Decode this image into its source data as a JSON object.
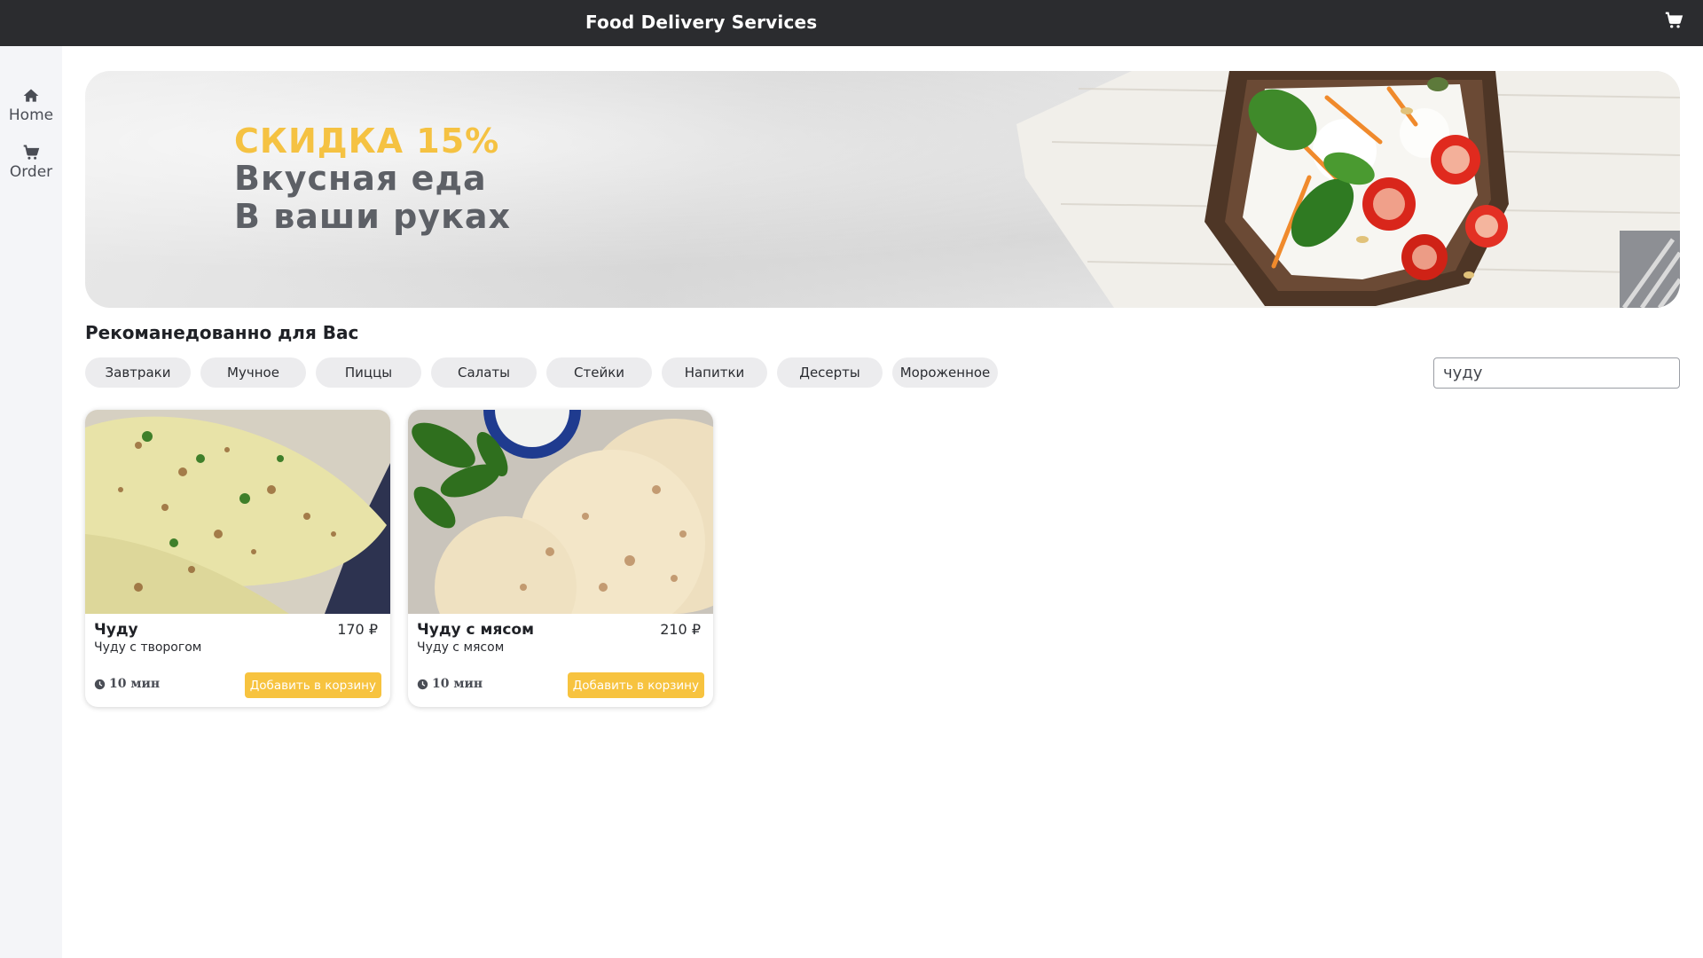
{
  "header": {
    "title": "Food Delivery Services",
    "cart_icon": "cart-icon"
  },
  "sidebar": {
    "items": [
      {
        "label": "Home",
        "icon": "home-icon"
      },
      {
        "label": "Order",
        "icon": "cart-icon"
      }
    ]
  },
  "banner": {
    "promo": "СКИДКА 15%",
    "line1": "Вкусная еда",
    "line2": "В ваши руках",
    "promo_color": "#f5c242"
  },
  "section": {
    "title": "Рекоманедованно для Вас"
  },
  "categories": [
    "Завтраки",
    "Мучное",
    "Пиццы",
    "Салаты",
    "Стейки",
    "Напитки",
    "Десерты",
    "Мороженное"
  ],
  "search": {
    "value": "чуду",
    "placeholder": ""
  },
  "products": [
    {
      "name": "Чуду",
      "price": "170 ₽",
      "description": "Чуду с творогом",
      "time": "10 мин",
      "button": "Добавить в корзину"
    },
    {
      "name": "Чуду с мясом",
      "price": "210 ₽",
      "description": "Чуду с мясом",
      "time": "10 мин",
      "button": "Добавить в корзину"
    }
  ],
  "colors": {
    "accent": "#f7c33f",
    "topbar": "#2b2c2f",
    "sidebar": "#f4f5f8"
  }
}
